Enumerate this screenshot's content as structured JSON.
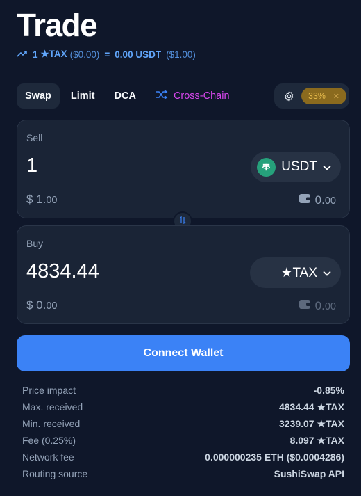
{
  "header": {
    "title": "Trade"
  },
  "rate": {
    "sell_amount": "1",
    "sell_token": "★TAX",
    "sell_usd": "($0.00)",
    "equals": "=",
    "buy_value": "0.00 USDT",
    "buy_usd": "($1.00)"
  },
  "tabs": [
    {
      "label": "Swap",
      "active": true
    },
    {
      "label": "Limit"
    },
    {
      "label": "DCA"
    },
    {
      "label": "Cross-Chain"
    }
  ],
  "settings": {
    "slippage": "33%",
    "clear_glyph": "✕"
  },
  "sell": {
    "label": "Sell",
    "amount": "1",
    "token": "USDT",
    "usd_prefix": "$ 1.",
    "usd_cents": "00",
    "balance_main": "0.",
    "balance_cents": "00"
  },
  "buy": {
    "label": "Buy",
    "amount": "4834.44",
    "token": "★TAX",
    "usd_prefix": "$ 0.",
    "usd_cents": "00",
    "balance_main": "0.",
    "balance_cents": "00"
  },
  "connect": {
    "label": "Connect Wallet"
  },
  "details": [
    {
      "label": "Price impact",
      "value": "-0.85%"
    },
    {
      "label": "Max. received",
      "value": "4834.44 ★TAX"
    },
    {
      "label": "Min. received",
      "value": "3239.07 ★TAX"
    },
    {
      "label": "Fee (0.25%)",
      "value": "8.097 ★TAX"
    },
    {
      "label": "Network fee",
      "value": "0.000000235 ETH ($0.0004286)"
    },
    {
      "label": "Routing source",
      "value": "SushiSwap API"
    }
  ],
  "colors": {
    "accent": "#3b82f6",
    "cross_chain": "#d946ef",
    "slippage_bg": "#8a6a1e",
    "tether": "#26a17b"
  },
  "icons": [
    "trend-up-icon",
    "shuffle-icon",
    "gear-icon",
    "close-icon",
    "tether-icon",
    "chevron-down-icon",
    "wallet-icon",
    "swap-arrows-icon"
  ]
}
